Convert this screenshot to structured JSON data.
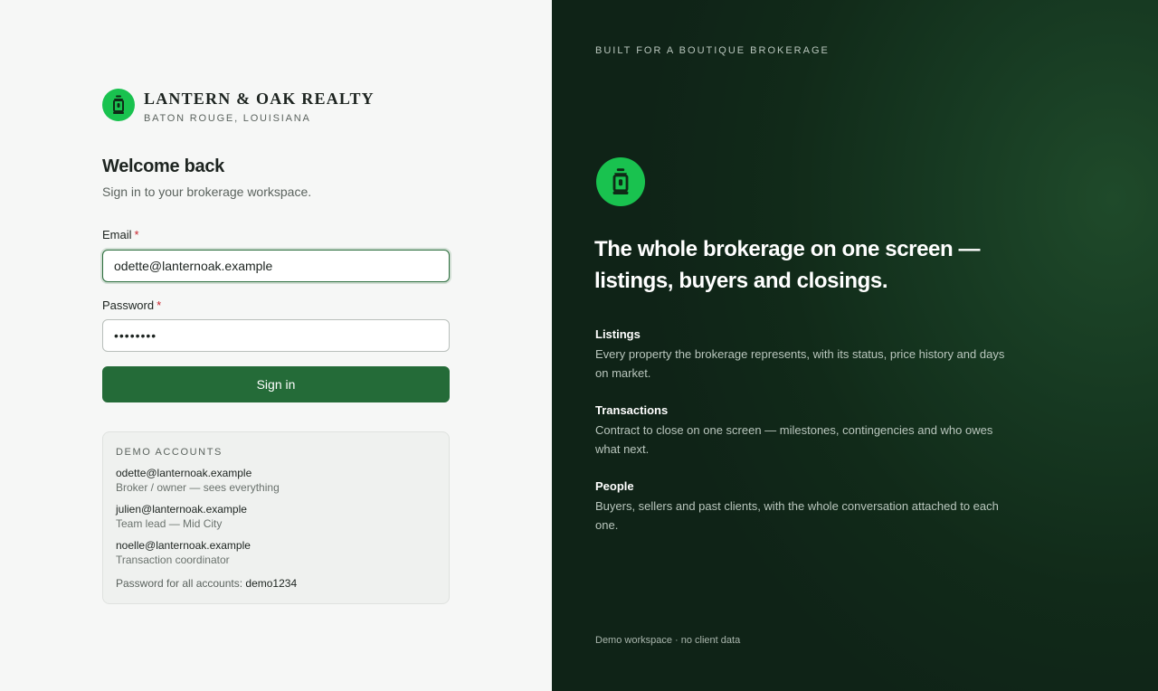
{
  "brand": {
    "name": "LANTERN & OAK REALTY",
    "location": "BATON ROUGE, LOUISIANA",
    "accent_color": "#19c24f",
    "logo_icon": "lantern-icon"
  },
  "form": {
    "heading": "Welcome back",
    "subtitle": "Sign in to your brokerage workspace.",
    "email_label": "Email",
    "email_value": "odette@lanternoak.example",
    "password_label": "Password",
    "password_value": "••••••••",
    "required_mark": "*",
    "submit_label": "Sign in",
    "submit_color": "#246b38"
  },
  "demo": {
    "title": "DEMO ACCOUNTS",
    "accounts": [
      {
        "email": "odette@lanternoak.example",
        "role": "Broker / owner — sees everything"
      },
      {
        "email": "julien@lanternoak.example",
        "role": "Team lead — Mid City"
      },
      {
        "email": "noelle@lanternoak.example",
        "role": "Transaction coordinator"
      }
    ],
    "password_note": "Password for all accounts:",
    "password": "demo1234"
  },
  "promo": {
    "kicker": "BUILT FOR A BOUTIQUE BROKERAGE",
    "headline": "The whole brokerage on one screen — listings, buyers and closings.",
    "features": [
      {
        "title": "Listings",
        "desc": "Every property the brokerage represents, with its status, price history and days on market."
      },
      {
        "title": "Transactions",
        "desc": "Contract to close on one screen — milestones, contingencies and who owes what next."
      },
      {
        "title": "People",
        "desc": "Buyers, sellers and past clients, with the whole conversation attached to each one."
      }
    ],
    "footnote": "Demo workspace · no client data"
  }
}
